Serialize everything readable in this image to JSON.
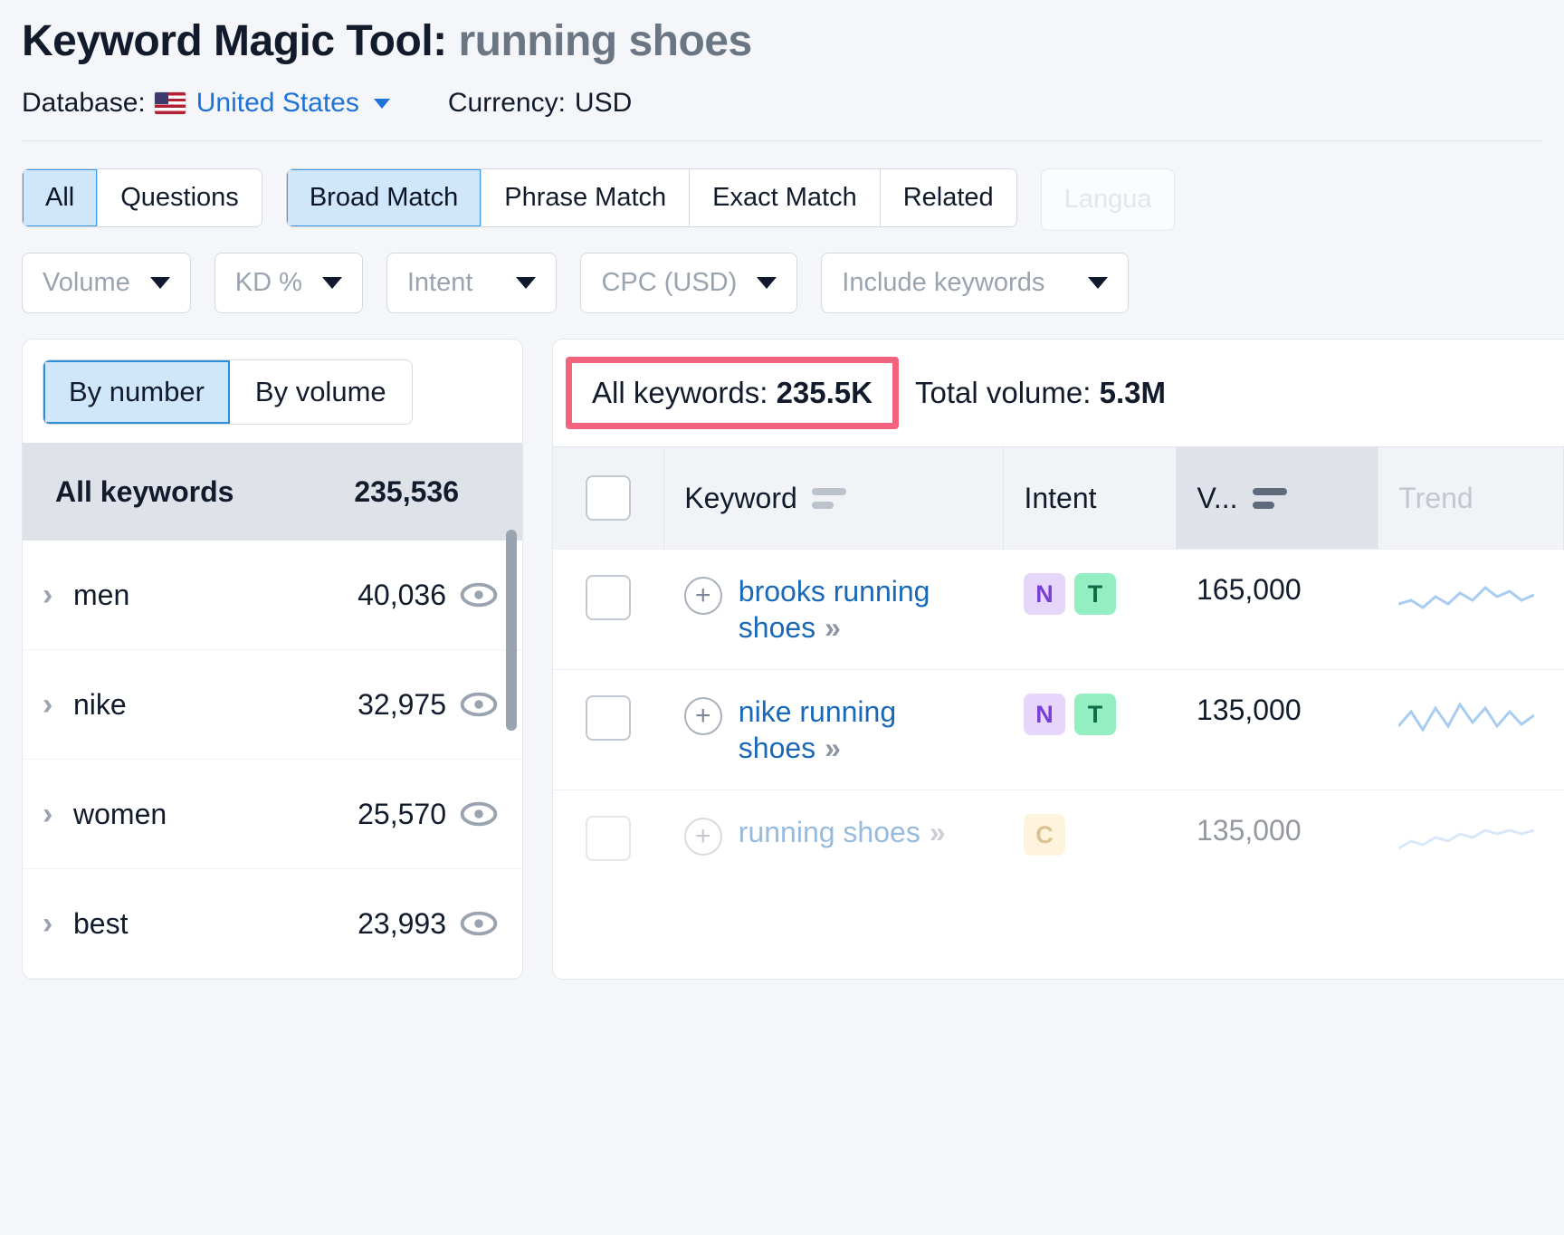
{
  "header": {
    "title_prefix": "Keyword Magic Tool:",
    "query": "running shoes",
    "database_label": "Database:",
    "database_value": "United States",
    "currency_label": "Currency:",
    "currency_value": "USD",
    "flag_icon": "us-flag-icon",
    "dropdown_icon": "chevron-down-icon"
  },
  "filters": {
    "type_tabs": [
      {
        "label": "All",
        "active": true
      },
      {
        "label": "Questions",
        "active": false
      }
    ],
    "match_tabs": [
      {
        "label": "Broad Match",
        "active": true
      },
      {
        "label": "Phrase Match",
        "active": false
      },
      {
        "label": "Exact Match",
        "active": false
      },
      {
        "label": "Related",
        "active": false
      }
    ],
    "language_chip": "Langua",
    "selects": [
      {
        "label": "Volume"
      },
      {
        "label": "KD %"
      },
      {
        "label": "Intent"
      },
      {
        "label": "CPC (USD)"
      },
      {
        "label": "Include keywords"
      }
    ]
  },
  "sidebar": {
    "toggle": [
      {
        "label": "By number",
        "active": true
      },
      {
        "label": "By volume",
        "active": false
      }
    ],
    "header_row": {
      "label": "All keywords",
      "count": "235,536"
    },
    "groups": [
      {
        "label": "men",
        "count": "40,036",
        "icon": "eye-icon"
      },
      {
        "label": "nike",
        "count": "32,975",
        "icon": "eye-icon"
      },
      {
        "label": "women",
        "count": "25,570",
        "icon": "eye-icon"
      },
      {
        "label": "best",
        "count": "23,993",
        "icon": "eye-icon"
      }
    ]
  },
  "results": {
    "all_keywords_label": "All keywords:",
    "all_keywords_value": "235.5K",
    "total_volume_label": "Total volume:",
    "total_volume_value": "5.3M",
    "highlight_color": "#f4637d",
    "columns": [
      {
        "key": "checkbox",
        "label": ""
      },
      {
        "key": "keyword",
        "label": "Keyword",
        "sort": true
      },
      {
        "key": "intent",
        "label": "Intent",
        "sort": false
      },
      {
        "key": "volume",
        "label": "V...",
        "sort": true,
        "active": true
      },
      {
        "key": "trend",
        "label": "Trend",
        "sort": false
      }
    ],
    "rows": [
      {
        "keyword": "brooks running shoes",
        "intent": [
          "N",
          "T"
        ],
        "volume": "165,000",
        "trend": [
          6,
          7,
          5,
          8,
          6,
          9,
          7,
          10,
          8,
          9,
          7,
          8
        ],
        "faded": false
      },
      {
        "keyword": "nike running shoes",
        "intent": [
          "N",
          "T"
        ],
        "volume": "135,000",
        "trend": [
          5,
          9,
          4,
          10,
          5,
          11,
          6,
          10,
          5,
          9,
          6,
          8
        ],
        "faded": false
      },
      {
        "keyword": "running shoes",
        "intent": [
          "C"
        ],
        "volume": "135,000",
        "trend": [
          4,
          6,
          5,
          7,
          6,
          8,
          7,
          9,
          8,
          9,
          8,
          9
        ],
        "faded": true
      }
    ]
  }
}
